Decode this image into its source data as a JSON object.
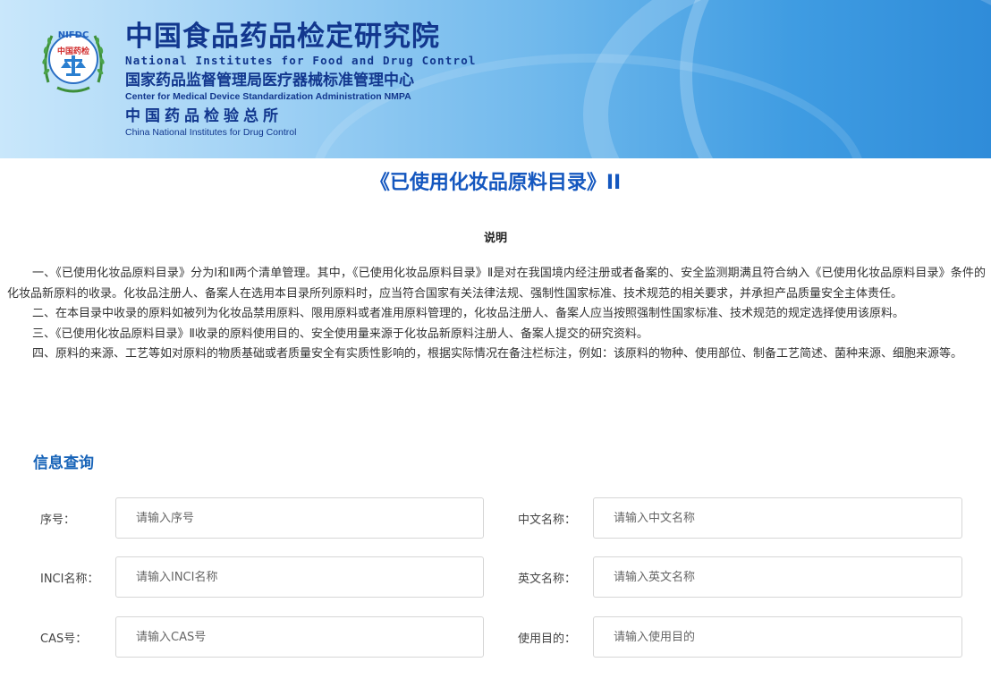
{
  "header": {
    "logo_text_top": "NIFDC",
    "logo_badge": "中国药检",
    "org_cn_1": "中国食品药品检定研究院",
    "org_en_1": "National Institutes for Food and Drug Control",
    "org_cn_2": "国家药品监督管理局医疗器械标准管理中心",
    "org_en_2": "Center for Medical Device Standardization Administration NMPA",
    "org_cn_3": "中国药品检验总所",
    "org_en_3": "China National Institutes for Drug Control"
  },
  "page_title": "《已使用化妆品原料目录》II",
  "description": {
    "heading": "说明",
    "paragraphs": [
      "一、《已使用化妆品原料目录》分为Ⅰ和Ⅱ两个清单管理。其中，《已使用化妆品原料目录》Ⅱ是对在我国境内经注册或者备案的、安全监测期满且符合纳入《已使用化妆品原料目录》条件的化妆品新原料的收录。化妆品注册人、备案人在选用本目录所列原料时，应当符合国家有关法律法规、强制性国家标准、技术规范的相关要求，并承担产品质量安全主体责任。",
      "二、在本目录中收录的原料如被列为化妆品禁用原料、限用原料或者准用原料管理的，化妆品注册人、备案人应当按照强制性国家标准、技术规范的规定选择使用该原料。",
      "三、《已使用化妆品原料目录》Ⅱ收录的原料使用目的、安全使用量来源于化妆品新原料注册人、备案人提交的研究资料。",
      "四、原料的来源、工艺等如对原料的物质基础或者质量安全有实质性影响的，根据实际情况在备注栏标注，例如：该原料的物种、使用部位、制备工艺简述、菌种来源、细胞来源等。"
    ]
  },
  "query": {
    "title": "信息查询",
    "fields": [
      {
        "label": "序号：",
        "placeholder": "请输入序号"
      },
      {
        "label": "中文名称：",
        "placeholder": "请输入中文名称"
      },
      {
        "label": "INCI名称：",
        "placeholder": "请输入INCI名称"
      },
      {
        "label": "英文名称：",
        "placeholder": "请输入英文名称"
      },
      {
        "label": "CAS号：",
        "placeholder": "请输入CAS号"
      },
      {
        "label": "使用目的：",
        "placeholder": "请输入使用目的"
      }
    ]
  },
  "colors": {
    "title_blue": "#1457bf",
    "section_blue": "#1763b8",
    "org_navy": "#12378e"
  }
}
